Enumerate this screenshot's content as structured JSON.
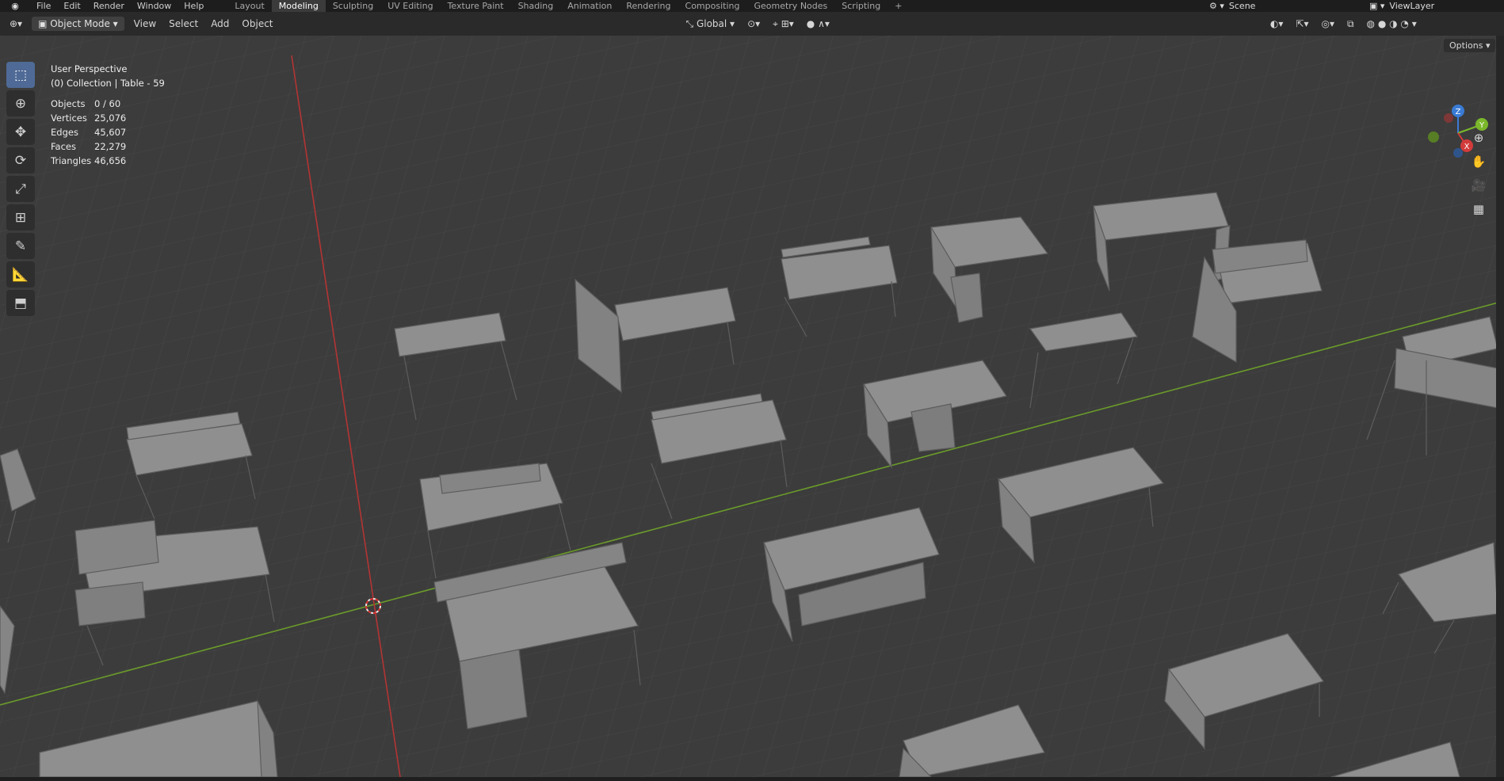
{
  "menus": [
    "File",
    "Edit",
    "Render",
    "Window",
    "Help"
  ],
  "workspace_tabs": [
    "Layout",
    "Modeling",
    "Sculpting",
    "UV Editing",
    "Texture Paint",
    "Shading",
    "Animation",
    "Rendering",
    "Compositing",
    "Geometry Nodes",
    "Scripting",
    "+"
  ],
  "active_tab": "Modeling",
  "scene_label": "Scene",
  "viewlayer_label": "ViewLayer",
  "header": {
    "mode": "Object Mode",
    "menus": [
      "View",
      "Select",
      "Add",
      "Object"
    ],
    "transform_orientation": "Global",
    "options_label": "Options"
  },
  "viewport_info": {
    "perspective": "User Perspective",
    "collection": "(0) Collection | Table - 59"
  },
  "stats": [
    {
      "label": "Objects",
      "value": "0 / 60"
    },
    {
      "label": "Vertices",
      "value": "25,076"
    },
    {
      "label": "Edges",
      "value": "45,607"
    },
    {
      "label": "Faces",
      "value": "22,279"
    },
    {
      "label": "Triangles",
      "value": "46,656"
    }
  ],
  "gizmo_axes": [
    "Z",
    "Y",
    "X"
  ],
  "colors": {
    "x_axis": "#d23b3b",
    "y_axis": "#7bb82b",
    "z_axis": "#3a7bd5",
    "active_tool": "#4f6a96"
  },
  "tools_left": [
    "select-box-icon",
    "cursor-icon",
    "move-icon",
    "rotate-icon",
    "scale-icon",
    "transform-icon",
    "annotate-icon",
    "measure-icon",
    "add-cube-icon"
  ],
  "tools_right": [
    "zoom-icon",
    "hand-icon",
    "camera-icon",
    "grid-icon"
  ]
}
